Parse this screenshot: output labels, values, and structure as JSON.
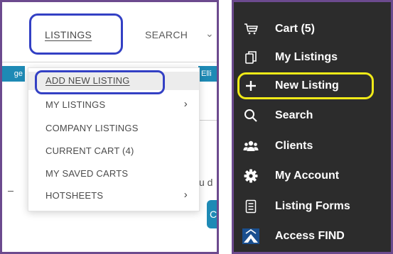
{
  "left": {
    "nav": {
      "listings": "LISTINGS",
      "search": "SEARCH"
    },
    "strip_left": "ge",
    "strip_right": "Elli",
    "bg_text": "u d",
    "bg_button": "C",
    "dropdown": [
      {
        "label": "ADD NEW LISTING",
        "chevron": false,
        "active": true
      },
      {
        "label": "MY LISTINGS",
        "chevron": true
      },
      {
        "label": "COMPANY LISTINGS",
        "chevron": false
      },
      {
        "label": "CURRENT CART (4)",
        "chevron": false
      },
      {
        "label": "MY SAVED CARTS",
        "chevron": false
      },
      {
        "label": "HOTSHEETS",
        "chevron": true
      }
    ]
  },
  "right": {
    "menu": [
      {
        "label": "Cart (5)",
        "icon": "cart-icon"
      },
      {
        "label": "My Listings",
        "icon": "copy-icon"
      },
      {
        "label": "New Listing",
        "icon": "plus-icon",
        "highlight": true
      },
      {
        "label": "Search",
        "icon": "search-icon"
      },
      {
        "label": "Clients",
        "icon": "users-icon"
      },
      {
        "label": "My Account",
        "icon": "gear-icon"
      },
      {
        "label": "Listing Forms",
        "icon": "document-icon"
      },
      {
        "label": "Access FIND",
        "icon": "find-logo-icon"
      }
    ]
  },
  "colors": {
    "border": "#6c4a8e",
    "blue_ring": "#3340c4",
    "yellow_ring": "#f0ea18",
    "dark_bg": "#2c2c2c",
    "accent": "#1e8ab5"
  }
}
